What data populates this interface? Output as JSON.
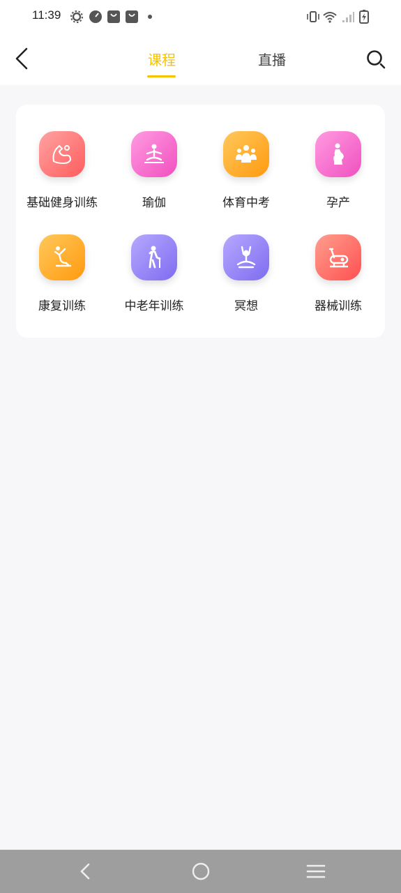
{
  "status_bar": {
    "time": "11:39",
    "icons": [
      "settings-icon",
      "speedometer-icon",
      "shopping-bag-icon",
      "shopping-bag-icon",
      "dot-icon",
      "vibrate-icon",
      "wifi-icon",
      "signal-icon",
      "battery-charging-icon"
    ]
  },
  "header": {
    "tabs": [
      {
        "label": "课程",
        "active": true
      },
      {
        "label": "直播",
        "active": false
      }
    ],
    "accent_color": "#f5c400"
  },
  "categories": [
    {
      "label": "基础健身训练",
      "icon": "muscle-arm-icon",
      "color": "#ff6f6f"
    },
    {
      "label": "瑜伽",
      "icon": "yoga-pose-icon",
      "color": "#f060c8"
    },
    {
      "label": "体育中考",
      "icon": "group-students-icon",
      "color": "#ffa020"
    },
    {
      "label": "孕产",
      "icon": "pregnant-icon",
      "color": "#f060c8"
    },
    {
      "label": "康复训练",
      "icon": "stretch-icon",
      "color": "#ffa020"
    },
    {
      "label": "中老年训练",
      "icon": "elderly-cane-icon",
      "color": "#8f7cf0"
    },
    {
      "label": "冥想",
      "icon": "meditation-icon",
      "color": "#8f7cf0"
    },
    {
      "label": "器械训练",
      "icon": "exercise-bike-icon",
      "color": "#ff6060"
    }
  ]
}
